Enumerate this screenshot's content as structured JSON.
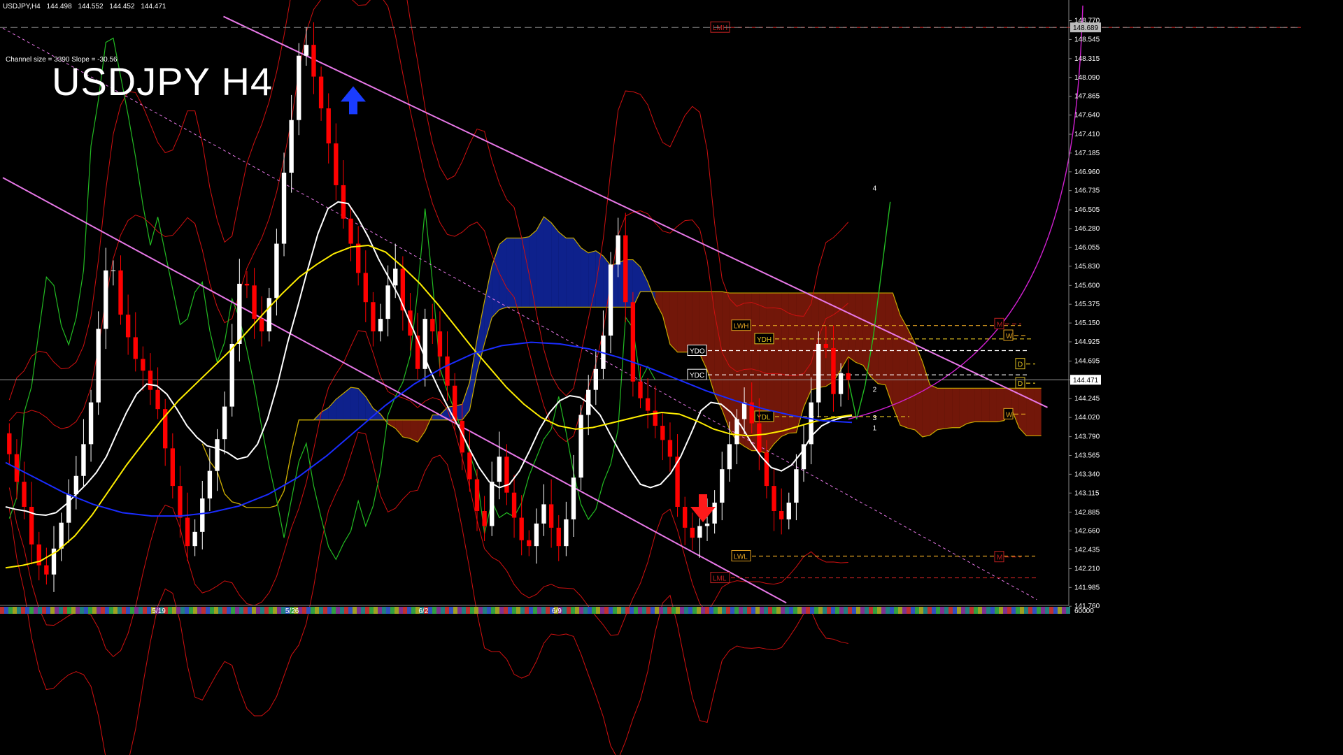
{
  "header": {
    "symbol": "USDJPY,H4",
    "open": "144.498",
    "high": "144.552",
    "low": "144.452",
    "close": "144.471"
  },
  "channel_info": "Channel size = 3390 Slope = -30.56",
  "title": "USDJPY H4",
  "colors": {
    "background": "#000000",
    "bull_candle": "#ffffff",
    "bear_candle": "#ff0000",
    "channel": "#e878e8",
    "kumo_bull": "#1a3cff",
    "kumo_bear": "#d02a10",
    "ma_white": "#ffffff",
    "ma_yellow": "#ffee00",
    "ma_blue": "#1a2cff",
    "chikou_green": "#22bb22",
    "bands_red": "#d01010",
    "senkou_gold": "#c8aa00"
  },
  "icons": {
    "up_arrow": "blue-up-arrow-icon",
    "down_arrow": "red-down-arrow-icon"
  },
  "chart_data": {
    "type": "candlestick",
    "ylim": [
      141.77,
      148.95
    ],
    "price_ticks": [
      "148.770",
      "148.545",
      "148.315",
      "148.090",
      "147.865",
      "147.640",
      "147.410",
      "147.185",
      "146.960",
      "146.735",
      "146.505",
      "146.280",
      "146.055",
      "145.830",
      "145.600",
      "145.375",
      "145.150",
      "144.925",
      "144.695",
      "144.470",
      "144.245",
      "144.020",
      "143.790",
      "143.565",
      "143.340",
      "143.115",
      "142.885",
      "142.660",
      "142.435",
      "142.210",
      "141.985",
      "141.760"
    ],
    "current_price": "144.471",
    "top_price_label": "148.689",
    "top_price_value": 148.689,
    "date_labels": [
      {
        "label": "5/19",
        "x": 0.14
      },
      {
        "label": "5/26",
        "x": 0.265
      },
      {
        "label": "6/2",
        "x": 0.39
      },
      {
        "label": "6/9",
        "x": 0.515
      }
    ],
    "bottom_scale_label": "60000",
    "key_levels": [
      {
        "label": "LMH",
        "price": 148.689,
        "color": "#c02020"
      },
      {
        "label": "LWH",
        "price": 145.12,
        "color": "#e0a020"
      },
      {
        "label": "YDH",
        "price": 144.96,
        "color": "#e0c020"
      },
      {
        "label": "YDO",
        "price": 144.82,
        "color": "#ffffff"
      },
      {
        "label": "YDC",
        "price": 144.53,
        "color": "#ffffff"
      },
      {
        "label": "YDL",
        "price": 144.03,
        "color": "#e0c020"
      },
      {
        "label": "LWL",
        "price": 142.36,
        "color": "#e0a020"
      },
      {
        "label": "LML",
        "price": 142.1,
        "color": "#c02020"
      },
      {
        "label": "M",
        "price": 145.14,
        "color": "#c02020"
      },
      {
        "label": "W",
        "price": 145.0,
        "color": "#e0a020"
      },
      {
        "label": "D",
        "price": 144.66,
        "color": "#e0c020"
      },
      {
        "label": "D",
        "price": 144.43,
        "color": "#e0c020"
      },
      {
        "label": "W",
        "price": 144.06,
        "color": "#e0a020"
      },
      {
        "label": "M",
        "price": 142.35,
        "color": "#c02020"
      }
    ],
    "wave_labels": [
      {
        "label": "4",
        "x": 0.816,
        "price": 146.77
      },
      {
        "label": "2",
        "x": 0.816,
        "price": 144.36
      },
      {
        "label": "3",
        "x": 0.816,
        "price": 144.02
      },
      {
        "label": "1",
        "x": 0.816,
        "price": 143.9
      }
    ],
    "closes": [
      143.58,
      143.25,
      142.95,
      142.5,
      142.25,
      142.14,
      142.45,
      142.76,
      143.1,
      143.32,
      143.7,
      144.2,
      145.08,
      145.78,
      145.78,
      145.25,
      144.98,
      144.72,
      144.58,
      144.35,
      144.12,
      143.65,
      143.2,
      142.82,
      142.48,
      142.65,
      143.05,
      143.38,
      143.76,
      144.15,
      144.9,
      145.62,
      145.6,
      145.2,
      145.05,
      145.45,
      146.1,
      146.95,
      147.58,
      148.35,
      148.48,
      148.1,
      147.72,
      147.3,
      146.8,
      146.4,
      146.1,
      145.75,
      145.4,
      145.05,
      145.2,
      145.6,
      145.8,
      145.3,
      145.0,
      144.6,
      145.2,
      145.05,
      144.75,
      144.4,
      143.98,
      143.6,
      143.28,
      142.9,
      142.72,
      143.25,
      143.55,
      143.12,
      142.82,
      142.55,
      142.48,
      142.75,
      142.98,
      142.7,
      142.48,
      142.8,
      143.3,
      144.05,
      144.35,
      144.6,
      145.0,
      145.85,
      146.2,
      145.4,
      144.45,
      144.25,
      144.1,
      143.92,
      143.75,
      143.55,
      142.95,
      142.7,
      142.58,
      142.72,
      142.75,
      143.0,
      143.4,
      143.7,
      144.0,
      144.2,
      143.95,
      143.6,
      143.2,
      142.9,
      142.8,
      143.0,
      143.4,
      143.7,
      144.2,
      144.9,
      144.85,
      144.3,
      144.55,
      144.47
    ],
    "moving_averages": [
      {
        "name": "white",
        "color": "#ffffff",
        "values": [
          142.95,
          142.92,
          142.9,
          142.86,
          142.85,
          142.88,
          142.98,
          143.1,
          143.22,
          143.36,
          143.55,
          143.82,
          144.08,
          144.3,
          144.42,
          144.4,
          144.3,
          144.12,
          143.92,
          143.78,
          143.68,
          143.65,
          143.6,
          143.52,
          143.55,
          143.7,
          144.0,
          144.42,
          144.92,
          145.35,
          145.8,
          146.22,
          146.52,
          146.6,
          146.58,
          146.4,
          146.18,
          145.92,
          145.7,
          145.48,
          145.2,
          144.92,
          144.62,
          144.36,
          144.12,
          143.9,
          143.65,
          143.42,
          143.25,
          143.18,
          143.22,
          143.38,
          143.62,
          143.88,
          144.08,
          144.22,
          144.28,
          144.26,
          144.18,
          144.05,
          143.82,
          143.6,
          143.4,
          143.22,
          143.18,
          143.22,
          143.35,
          143.55,
          143.82,
          144.1,
          144.2,
          144.18,
          144.08,
          143.92,
          143.72,
          143.55,
          143.42,
          143.38,
          143.45,
          143.6,
          143.8,
          143.92,
          143.98,
          144.02,
          144.04
        ],
        "skip": 0
      },
      {
        "name": "yellow",
        "color": "#ffee00",
        "values": [
          142.22,
          142.25,
          142.3,
          142.42,
          142.6,
          142.85,
          143.15,
          143.45,
          143.72,
          143.98,
          144.22,
          144.42,
          144.62,
          144.82,
          145.05,
          145.28,
          145.5,
          145.7,
          145.85,
          145.98,
          146.06,
          146.08,
          146.0,
          145.82,
          145.62,
          145.38,
          145.12,
          144.86,
          144.62,
          144.38,
          144.18,
          144.02,
          143.92,
          143.88,
          143.9,
          143.95,
          144.0,
          144.05,
          144.08,
          144.06,
          143.98,
          143.88,
          143.82,
          143.8,
          143.82,
          143.86,
          143.92,
          143.98,
          144.02,
          144.05
        ],
        "skip": 0
      },
      {
        "name": "blue",
        "color": "#1a2cff",
        "values": [
          143.48,
          143.3,
          143.12,
          142.98,
          142.88,
          142.84,
          142.84,
          142.88,
          142.96,
          143.1,
          143.3,
          143.56,
          143.86,
          144.16,
          144.42,
          144.62,
          144.78,
          144.88,
          144.92,
          144.9,
          144.84,
          144.74,
          144.62,
          144.48,
          144.34,
          144.22,
          144.12,
          144.04,
          143.98,
          143.96
        ],
        "skip": 0
      }
    ],
    "channel_lines": [
      {
        "from": [
          0.207,
          148.82
        ],
        "to": [
          0.98,
          144.14
        ]
      },
      {
        "from": [
          0.0,
          146.89
        ],
        "to": [
          0.735,
          141.8
        ]
      },
      {
        "from": [
          0.0,
          148.68
        ],
        "to": [
          0.97,
          141.84
        ],
        "dashed": true
      }
    ]
  }
}
